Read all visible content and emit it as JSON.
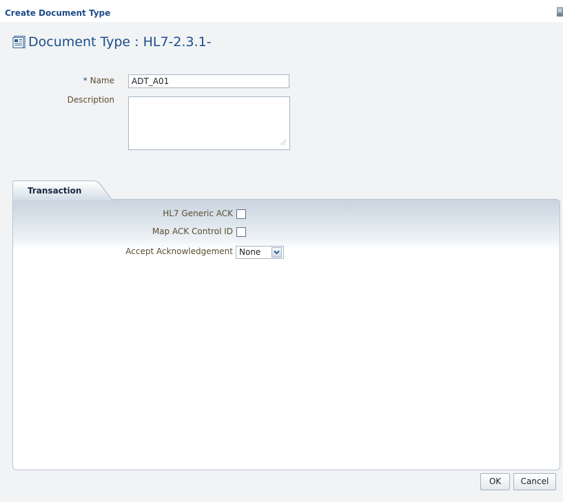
{
  "dialog": {
    "title": "Create Document Type",
    "close_icon": "close-icon"
  },
  "header": {
    "icon": "document-type-icon",
    "title": "Document Type : HL7-2.3.1-"
  },
  "form": {
    "name_required_marker": "*",
    "name_label": "Name",
    "name_value": "ADT_A01",
    "description_label": "Description",
    "description_value": ""
  },
  "tabs": [
    {
      "label": "Transaction",
      "selected": true
    }
  ],
  "transaction": {
    "generic_ack_label": "HL7 Generic ACK",
    "generic_ack_checked": false,
    "map_ack_label": "Map ACK Control ID",
    "map_ack_checked": false,
    "accept_ack_label": "Accept Acknowledgement",
    "accept_ack_value": "None"
  },
  "buttons": {
    "ok": "OK",
    "cancel": "Cancel"
  },
  "colors": {
    "title_blue": "#1d4e89",
    "label_brown": "#5a4d2e",
    "panel_header": "#c9d4de",
    "background": "#f1f3f5"
  }
}
